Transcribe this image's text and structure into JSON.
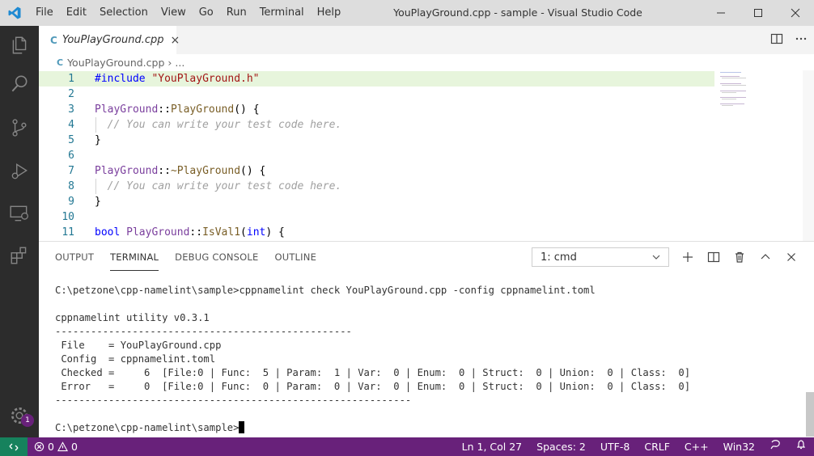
{
  "app": {
    "window_title": "YouPlayGround.cpp - sample - Visual Studio Code",
    "menu": [
      "File",
      "Edit",
      "Selection",
      "View",
      "Go",
      "Run",
      "Terminal",
      "Help"
    ]
  },
  "activity": {
    "badge": "1"
  },
  "tab": {
    "label": "YouPlayGround.cpp",
    "close": "×"
  },
  "breadcrumb": {
    "file": "YouPlayGround.cpp",
    "sep": "›",
    "more": "..."
  },
  "editor": {
    "lines": [
      {
        "n": "1",
        "tokens": [
          [
            "dir",
            "#include"
          ],
          [
            "plain",
            " "
          ],
          [
            "str",
            "\"YouPlayGround.h\""
          ]
        ]
      },
      {
        "n": "2",
        "tokens": []
      },
      {
        "n": "3",
        "tokens": [
          [
            "cls",
            "PlayGround"
          ],
          [
            "plain",
            "::"
          ],
          [
            "fn",
            "PlayGround"
          ],
          [
            "plain",
            "() {"
          ]
        ]
      },
      {
        "n": "4",
        "tokens": [
          [
            "plain",
            "  "
          ],
          [
            "cmt",
            "// You can write your test code here."
          ]
        ]
      },
      {
        "n": "5",
        "tokens": [
          [
            "plain",
            "}"
          ]
        ]
      },
      {
        "n": "6",
        "tokens": []
      },
      {
        "n": "7",
        "tokens": [
          [
            "cls",
            "PlayGround"
          ],
          [
            "plain",
            "::"
          ],
          [
            "fn",
            "~PlayGround"
          ],
          [
            "plain",
            "() {"
          ]
        ]
      },
      {
        "n": "8",
        "tokens": [
          [
            "plain",
            "  "
          ],
          [
            "cmt",
            "// You can write your test code here."
          ]
        ]
      },
      {
        "n": "9",
        "tokens": [
          [
            "plain",
            "}"
          ]
        ]
      },
      {
        "n": "10",
        "tokens": []
      },
      {
        "n": "11",
        "tokens": [
          [
            "kw",
            "bool"
          ],
          [
            "plain",
            " "
          ],
          [
            "cls",
            "PlayGround"
          ],
          [
            "plain",
            "::"
          ],
          [
            "fn",
            "IsVal1"
          ],
          [
            "plain",
            "("
          ],
          [
            "kw",
            "int"
          ],
          [
            "plain",
            ") {"
          ]
        ]
      }
    ]
  },
  "panel": {
    "tabs": [
      "OUTPUT",
      "TERMINAL",
      "DEBUG CONSOLE",
      "OUTLINE"
    ],
    "active_tab": "TERMINAL",
    "terminal_select": "1: cmd"
  },
  "terminal": {
    "lines": [
      "C:\\petzone\\cpp-namelint\\sample>cppnamelint check YouPlayGround.cpp -config cppnamelint.toml",
      "",
      "cppnamelint utility v0.3.1",
      "--------------------------------------------------",
      " File    = YouPlayGround.cpp",
      " Config  = cppnamelint.toml",
      " Checked =     6  [File:0 | Func:  5 | Param:  1 | Var:  0 | Enum:  0 | Struct:  0 | Union:  0 | Class:  0]",
      " Error   =     0  [File:0 | Func:  0 | Param:  0 | Var:  0 | Enum:  0 | Struct:  0 | Union:  0 | Class:  0]",
      "------------------------------------------------------------",
      "",
      "C:\\petzone\\cpp-namelint\\sample>"
    ]
  },
  "status": {
    "errors": "0",
    "warnings": "0",
    "position": "Ln 1, Col 27",
    "spaces": "Spaces: 2",
    "encoding": "UTF-8",
    "eol": "CRLF",
    "language": "C++",
    "platform": "Win32"
  },
  "colors": {
    "statusbar": "#68217a",
    "activitybar": "#2c2c2c",
    "accent": "#007acc"
  }
}
